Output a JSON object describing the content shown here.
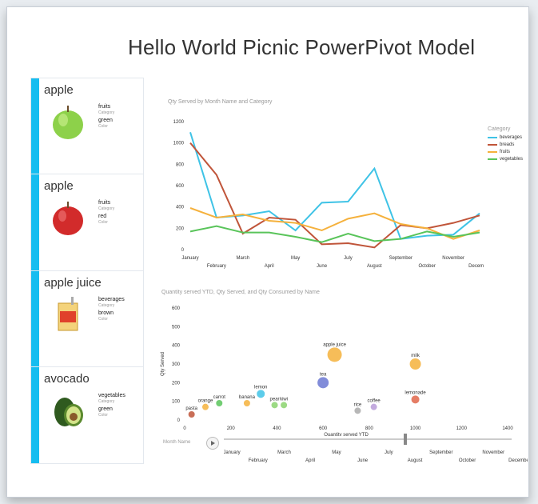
{
  "title": "Hello World Picnic PowerPivot Model",
  "cards": [
    {
      "name": "apple",
      "category": "fruits",
      "category_label": "Category",
      "color": "green",
      "color_label": "Color",
      "image": "green-apple-icon"
    },
    {
      "name": "apple",
      "category": "fruits",
      "category_label": "Category",
      "color": "red",
      "color_label": "Color",
      "image": "red-apple-icon"
    },
    {
      "name": "apple juice",
      "category": "beverages",
      "category_label": "Category",
      "color": "brown",
      "color_label": "Color",
      "image": "juice-box-icon"
    },
    {
      "name": "avocado",
      "category": "vegetables",
      "category_label": "Category",
      "color": "green",
      "color_label": "Color",
      "image": "avocado-icon"
    }
  ],
  "line_chart_title": "Qty Served by Month Name and Category",
  "scatter_chart_title": "Quantity served YTD, Qty Served, and Qty Consumed by Name",
  "legend": {
    "title": "Category",
    "items": [
      {
        "label": "beverages",
        "color": "#3fc3e6"
      },
      {
        "label": "breads",
        "color": "#c0553a"
      },
      {
        "label": "fruits",
        "color": "#f5b13c"
      },
      {
        "label": "vegetables",
        "color": "#59c45a"
      }
    ]
  },
  "play_axis": {
    "label": "Month Name"
  },
  "chart_data": [
    {
      "type": "line",
      "title": "Qty Served by Month Name and Category",
      "categories": [
        "January",
        "February",
        "March",
        "April",
        "May",
        "June",
        "July",
        "August",
        "September",
        "October",
        "November",
        "December"
      ],
      "ylim": [
        0,
        1200
      ],
      "yticks": [
        0,
        200,
        400,
        600,
        800,
        1000,
        1200
      ],
      "series": [
        {
          "name": "beverages",
          "values": [
            1100,
            300,
            320,
            360,
            180,
            440,
            450,
            760,
            100,
            130,
            140,
            340
          ]
        },
        {
          "name": "breads",
          "values": [
            1000,
            700,
            150,
            300,
            280,
            50,
            60,
            20,
            230,
            200,
            250,
            320
          ]
        },
        {
          "name": "fruits",
          "values": [
            390,
            300,
            330,
            270,
            250,
            180,
            290,
            340,
            240,
            200,
            100,
            180
          ]
        },
        {
          "name": "vegetables",
          "values": [
            170,
            220,
            160,
            160,
            120,
            70,
            150,
            80,
            100,
            170,
            120,
            160
          ]
        }
      ]
    },
    {
      "type": "scatter",
      "title": "Quantity served YTD, Qty Served, and Qty Consumed by Name",
      "xlabel": "Quantity served YTD",
      "ylabel": "Qty Served",
      "xlim": [
        0,
        1400
      ],
      "ylim": [
        0,
        600
      ],
      "xticks": [
        0,
        200,
        400,
        600,
        800,
        1000,
        1200,
        1400
      ],
      "yticks": [
        0,
        100,
        200,
        300,
        400,
        500,
        600
      ],
      "points": [
        {
          "label": "apple juice",
          "x": 650,
          "y": 350,
          "size": 9,
          "color": "#f5b13c"
        },
        {
          "label": "milk",
          "x": 1000,
          "y": 300,
          "size": 7,
          "color": "#f5b13c"
        },
        {
          "label": "tea",
          "x": 600,
          "y": 200,
          "size": 7,
          "color": "#6b78d2"
        },
        {
          "label": "lemonade",
          "x": 1000,
          "y": 110,
          "size": 5,
          "color": "#e0664a"
        },
        {
          "label": "lemon",
          "x": 330,
          "y": 140,
          "size": 5,
          "color": "#3fc3e6"
        },
        {
          "label": "carrot",
          "x": 150,
          "y": 90,
          "size": 4,
          "color": "#59c45a"
        },
        {
          "label": "banana",
          "x": 270,
          "y": 90,
          "size": 4,
          "color": "#f5b13c"
        },
        {
          "label": "pear",
          "x": 390,
          "y": 80,
          "size": 4,
          "color": "#8bd36f"
        },
        {
          "label": "kiwi",
          "x": 430,
          "y": 80,
          "size": 4,
          "color": "#8bd36f"
        },
        {
          "label": "orange",
          "x": 90,
          "y": 70,
          "size": 4,
          "color": "#f5b13c"
        },
        {
          "label": "pasta",
          "x": 30,
          "y": 30,
          "size": 4,
          "color": "#c0553a"
        },
        {
          "label": "rice",
          "x": 750,
          "y": 50,
          "size": 4,
          "color": "#aaa"
        },
        {
          "label": "coffee",
          "x": 820,
          "y": 70,
          "size": 4,
          "color": "#b89bd8"
        }
      ]
    }
  ]
}
